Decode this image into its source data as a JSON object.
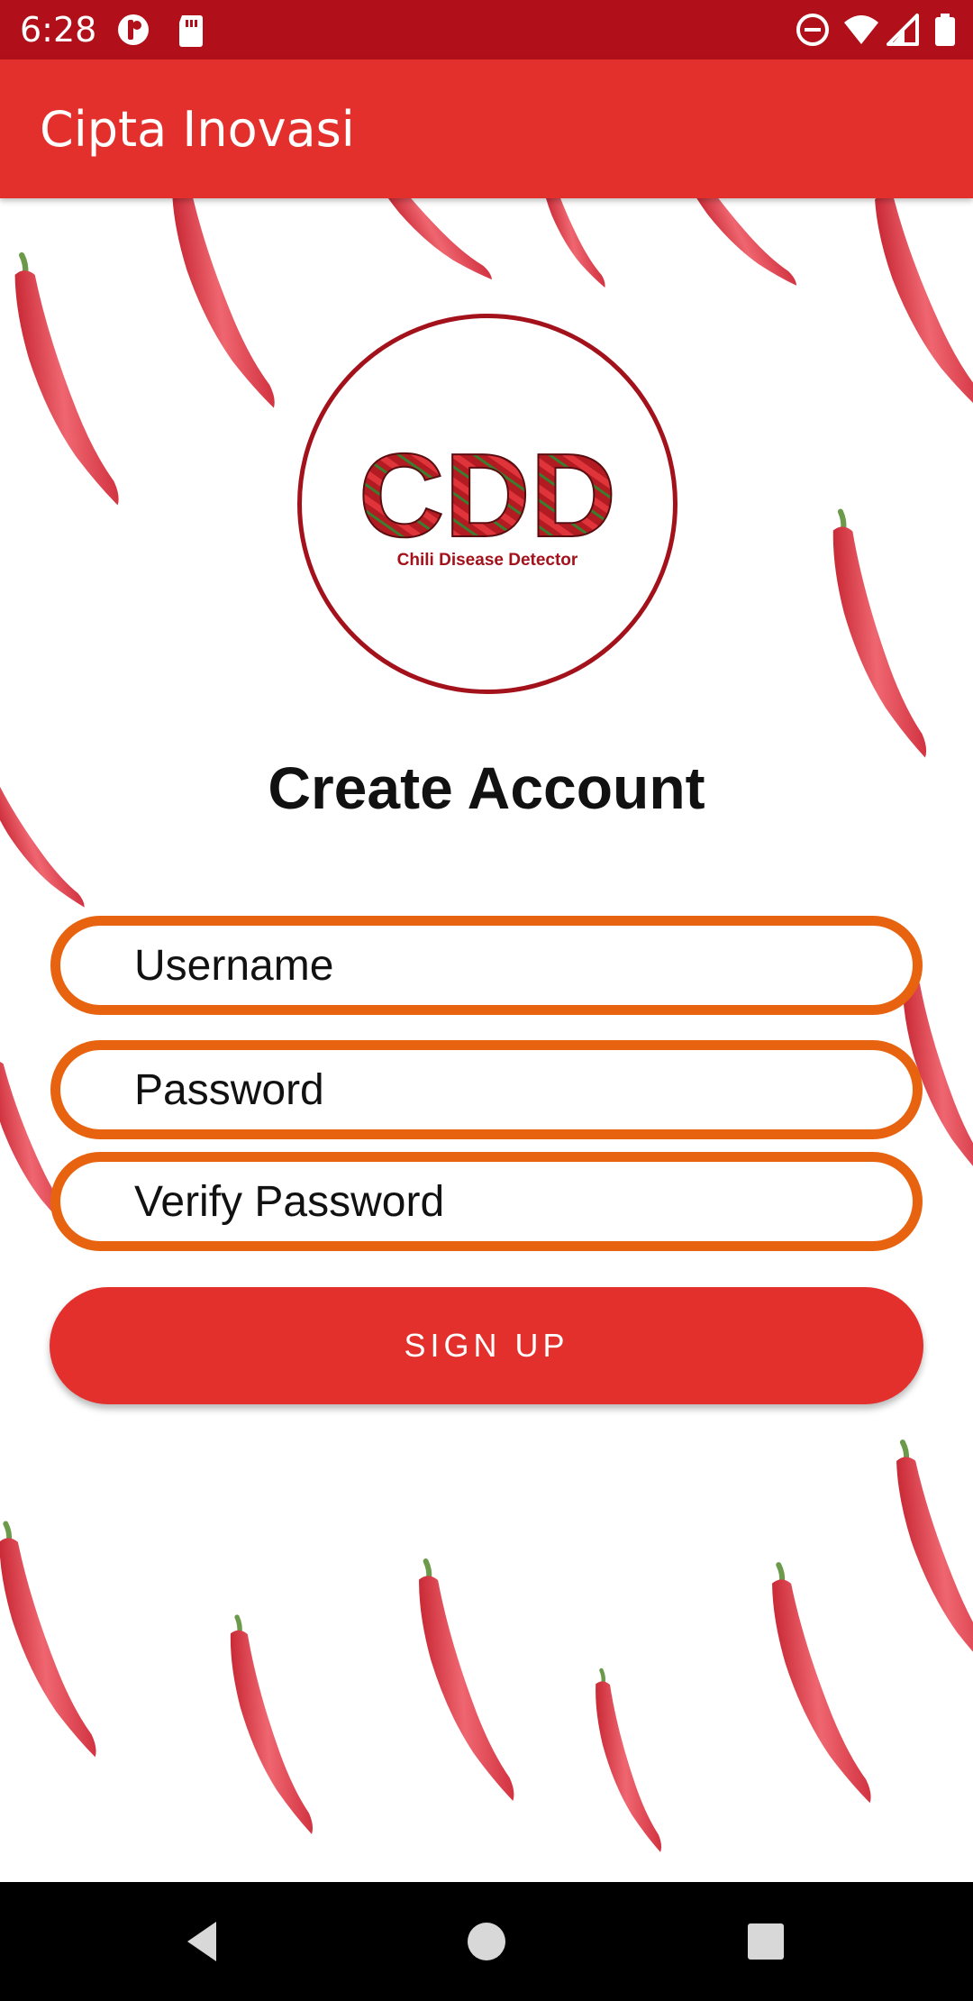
{
  "status_bar": {
    "time": "6:28",
    "icons": [
      "app-notification-icon",
      "sd-card-icon",
      "do-not-disturb-icon",
      "wifi-icon",
      "cell-signal-icon",
      "battery-icon"
    ]
  },
  "app_bar": {
    "title": "Cipta Inovasi"
  },
  "logo": {
    "acronym": "CDD",
    "caption": "Chili Disease Detector"
  },
  "form": {
    "heading": "Create Account",
    "username_placeholder": "Username",
    "password_placeholder": "Password",
    "verify_placeholder": "Verify Password",
    "signup_label": "SIGN UP"
  },
  "nav_bar": {
    "buttons": [
      "back-icon",
      "home-icon",
      "recents-icon"
    ]
  },
  "colors": {
    "status_bar": "#b1101a",
    "app_bar": "#e3302c",
    "input_border": "#e8630f",
    "button": "#e3302c",
    "logo_ring": "#a3111b"
  }
}
